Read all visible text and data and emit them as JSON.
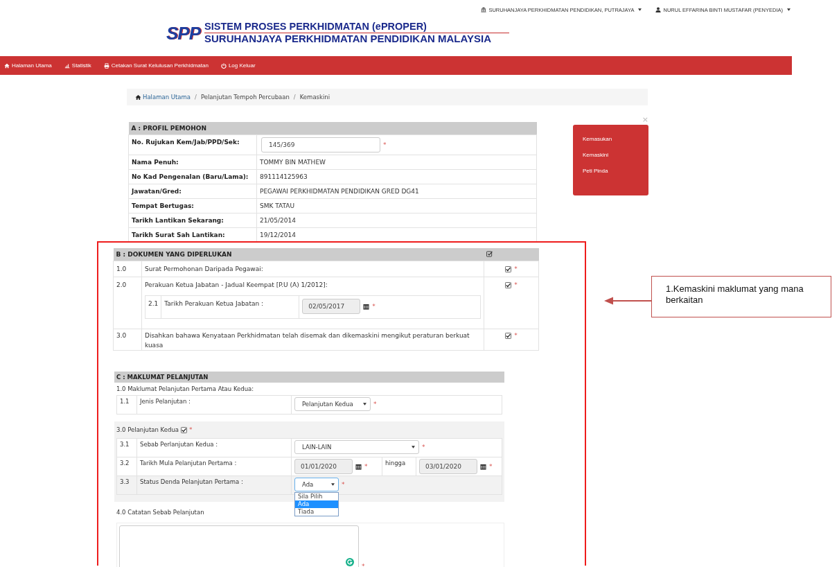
{
  "top_links": [
    {
      "label": "SURUHANJAYA PERKHIDMATAN PENDIDIKAN, PUTRAJAYA"
    },
    {
      "label": "NURUL EFFARINA BINTI MUSTAFAR (PENYEDIA)"
    }
  ],
  "logo": {
    "mark": "SPP",
    "title": "SISTEM PROSES PERKHIDMATAN (ePROPER)",
    "subtitle": "SURUHANJAYA PERKHIDMATAN PENDIDIKAN MALAYSIA"
  },
  "nav": [
    {
      "label": "Halaman Utama"
    },
    {
      "label": "Statistik"
    },
    {
      "label": "Cetakan Surat Kelulusan Perkhidmatan"
    },
    {
      "label": "Log Keluar"
    }
  ],
  "breadcrumb_separator": "/",
  "breadcrumb": [
    {
      "label": "Halaman Utama",
      "link": true
    },
    {
      "label": "Pelanjutan Tempoh Percubaan",
      "link": false
    },
    {
      "label": "Kemaskini",
      "link": false
    }
  ],
  "required_mark": "*",
  "section_a": {
    "title": "A : PROFIL PEMOHON",
    "rows": [
      {
        "label": "No. Rujukan Kem/Jab/PPD/Sek:",
        "value": "145/369",
        "kind": "input",
        "required": true
      },
      {
        "label": "Nama Penuh:",
        "value": "TOMMY BIN MATHEW",
        "kind": "text",
        "required": false
      },
      {
        "label": "No Kad Pengenalan (Baru/Lama):",
        "value": "891114125963",
        "kind": "text",
        "required": false
      },
      {
        "label": "Jawatan/Gred:",
        "value": "PEGAWAI PERKHIDMATAN PENDIDIKAN GRED DG41",
        "kind": "text",
        "required": false
      },
      {
        "label": "Tempat Bertugas:",
        "value": "SMK TATAU",
        "kind": "text",
        "required": false
      },
      {
        "label": "Tarikh Lantikan Sekarang:",
        "value": "21/05/2014",
        "kind": "text",
        "required": false
      },
      {
        "label": "Tarikh Surat Sah Lantikan:",
        "value": "19/12/2014",
        "kind": "text",
        "required": false
      }
    ]
  },
  "side_menu": {
    "close": "×",
    "items": [
      {
        "label": "Kemasukan"
      },
      {
        "label": "Kemaskini"
      },
      {
        "label": "Peti Pinda"
      }
    ]
  },
  "section_b": {
    "title": "B : DOKUMEN YANG DIPERLUKAN",
    "rows": [
      {
        "number": "1.0",
        "text": "Surat Permohonan Daripada Pegawai:",
        "checked": true,
        "required": true
      },
      {
        "number": "2.0",
        "text": "Perakuan Ketua Jabatan - Jadual Keempat [P.U (A) 1/2012]:",
        "checked": true,
        "required": true,
        "sub": {
          "number": "2.1",
          "label": "Tarikh Perakuan Ketua Jabatan :",
          "value": "02/05/2017",
          "required": true
        }
      },
      {
        "number": "3.0",
        "text": "Disahkan bahawa Kenyataan Perkhidmatan telah disemak dan dikemaskini mengikut peraturan berkuat kuasa",
        "checked": true,
        "required": true
      }
    ]
  },
  "section_c": {
    "title": "C : MAKLUMAT PELANJUTAN",
    "group_1": {
      "heading": "1.0 Maklumat Pelanjutan Pertama Atau Kedua:",
      "rows": [
        {
          "number": "1.1",
          "label": "Jenis Pelanjutan :",
          "kind": "select",
          "value": "Pelanjutan Kedua",
          "required": true
        }
      ]
    },
    "group_3": {
      "heading": "3.0 Pelanjutan Kedua",
      "checked": true,
      "required": true,
      "rows": [
        {
          "number": "3.1",
          "label": "Sebab Perlanjutan Kedua :",
          "kind": "select_wide",
          "value": "LAIN-LAIN",
          "required": true
        },
        {
          "number": "3.2",
          "label": "Tarikh Mula Pelanjutan Pertama :",
          "kind": "date_range",
          "value": "01/01/2020",
          "between": "hingga",
          "value_2": "03/01/2020",
          "required": true
        },
        {
          "number": "3.3",
          "label": "Status Denda Pelanjutan Pertama :",
          "kind": "select_open",
          "value": "Ada",
          "required": true,
          "options": [
            {
              "label": "Sila Pilih",
              "selected": false
            },
            {
              "label": "Ada",
              "selected": true
            },
            {
              "label": "Tiada",
              "selected": false
            }
          ]
        }
      ]
    },
    "group_4": {
      "heading": "4.0 Catatan Sebab Pelanjutan",
      "required": true
    }
  },
  "annotation": {
    "text": "1.Kemaskini maklumat yang mana berkaitan"
  }
}
